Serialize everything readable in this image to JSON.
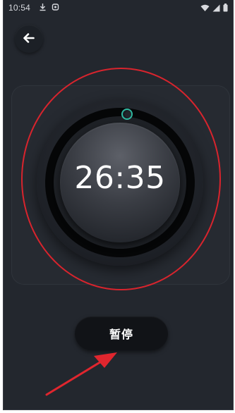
{
  "status_bar": {
    "time": "10:54",
    "left_icons": [
      "download-icon",
      "notification-icon"
    ],
    "right_icons": [
      "wifi-icon",
      "signal-icon",
      "battery-icon"
    ]
  },
  "header": {
    "back_icon": "arrow-left-icon"
  },
  "timer": {
    "remaining": "26:35",
    "progress_fraction": 0.03,
    "accent_color": "#2fb8a0"
  },
  "controls": {
    "pause_label": "暂停"
  },
  "annotation": {
    "color": "#d8242d"
  }
}
